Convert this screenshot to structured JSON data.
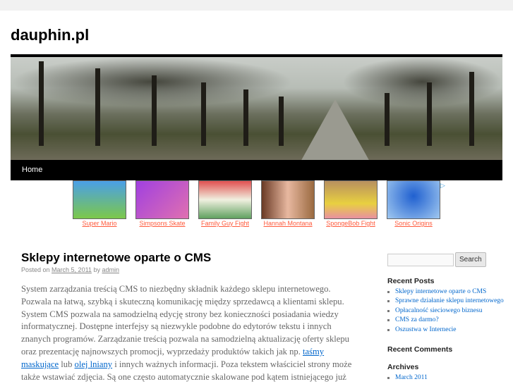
{
  "site": {
    "title": "dauphin.pl"
  },
  "menu": {
    "home": "Home"
  },
  "ads": [
    {
      "label": "Super Mario",
      "color": "#4a8fd8"
    },
    {
      "label": "Simpsons Skate",
      "color": "#b05ad0"
    },
    {
      "label": "Family Guy Fight",
      "color": "#d8c8a0"
    },
    {
      "label": "Hannah Montana",
      "color": "#8a5a40"
    },
    {
      "label": "SpongeBob Fight",
      "color": "#c8a050"
    },
    {
      "label": "Sonic Origins",
      "color": "#5a90e0"
    }
  ],
  "post": {
    "title": "Sklepy internetowe oparte o CMS",
    "posted_on": "Posted on",
    "date": "March 5, 2011",
    "by": "by",
    "author": "admin",
    "text1": "System zarządzania treścią CMS to niezbędny składnik każdego sklepu internetowego. Pozwala na łatwą, szybką i skuteczną komunikację między sprzedawcą a klientami sklepu. System CMS pozwala na samodzielną edycję strony bez konieczności posiadania wiedzy informatycznej. Dostępne interfejsy są niezwykle podobne do edytorów tekstu i innych znanych programów. Zarządzanie treścią pozwala na samodzielną aktualizację oferty sklepu oraz prezentację najnowszych promocji, wyprzedaży produktów takich jak np. ",
    "link1": "taśmy maskujące",
    "text2": " lub ",
    "link2": "olej lniany",
    "text3": " i innych ważnych informacji. Poza tekstem właściciel strony może także wstawiać zdjęcia. Są one często automatycznie skalowane pod kątem istniejącego już"
  },
  "sidebar": {
    "search_button": "Search",
    "recent_posts_title": "Recent Posts",
    "recent_posts": [
      "Sklepy internetowe oparte o CMS",
      "Sprawne działanie sklepu internetowego",
      "Opłacalność sieciowego biznesu",
      "CMS za darmo?",
      "Oszustwa w Internecie"
    ],
    "recent_comments_title": "Recent Comments",
    "archives_title": "Archives",
    "archives": [
      "March 2011"
    ]
  }
}
